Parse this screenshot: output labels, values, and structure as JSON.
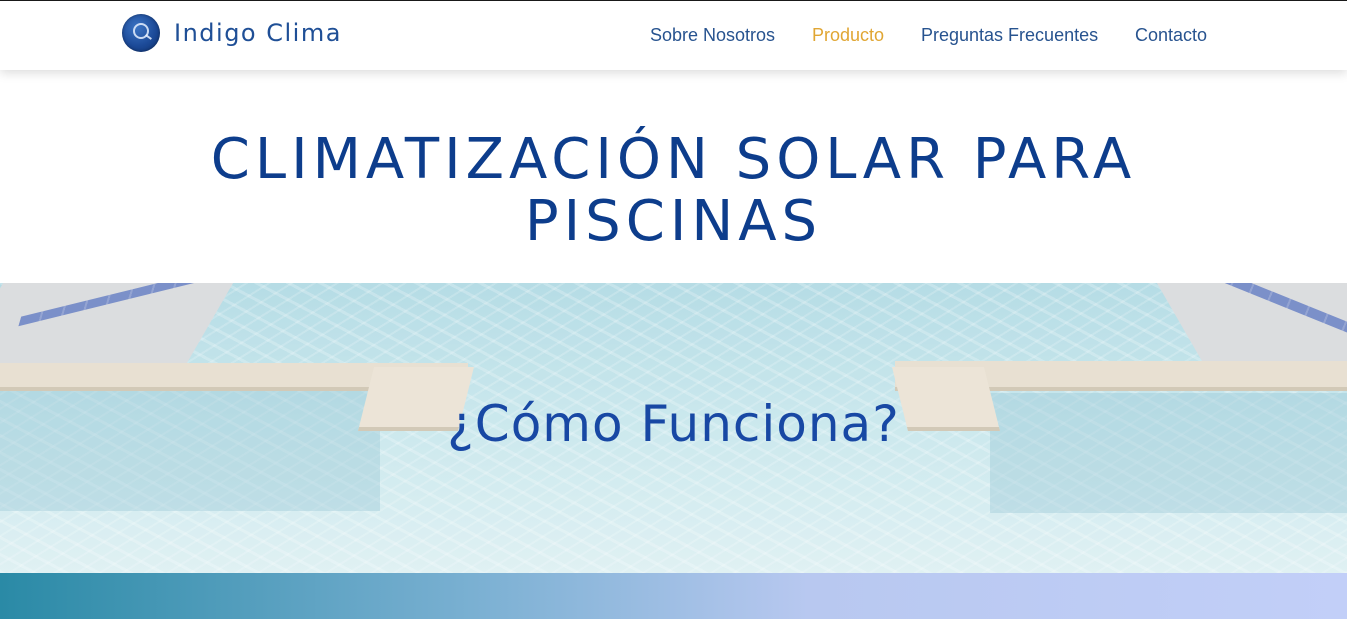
{
  "header": {
    "brand": "Indigo Clima",
    "nav": [
      {
        "label": "Sobre Nosotros"
      },
      {
        "label": "Producto",
        "active": true
      },
      {
        "label": "Preguntas Frecuentes"
      },
      {
        "label": "Contacto"
      }
    ]
  },
  "hero": {
    "title_line1": "CLIMATIZACIÓN SOLAR PARA",
    "title_line2": "PISCINAS"
  },
  "section": {
    "caption": "¿Cómo Funciona?"
  },
  "colors": {
    "brand_blue": "#0d3d8c",
    "nav_blue": "#27538f",
    "nav_active": "#e0a633"
  }
}
